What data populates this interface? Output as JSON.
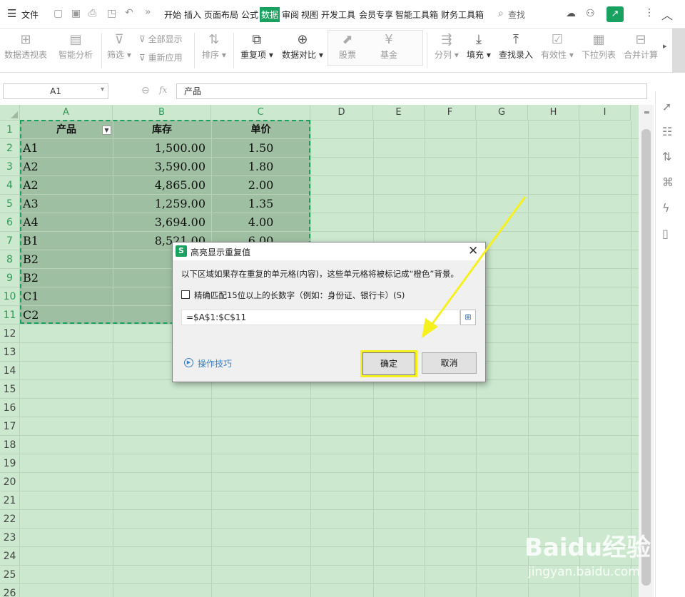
{
  "menubar": {
    "file": "文件",
    "tabs": [
      "开始",
      "插入",
      "页面布局",
      "公式",
      "数据",
      "审阅",
      "视图",
      "开发工具",
      "会员专享",
      "智能工具箱",
      "财务工具箱"
    ],
    "active_tab": "数据",
    "search": "查找"
  },
  "ribbon": {
    "pivot": "数据透视表",
    "smart": "智能分析",
    "filter": "筛选",
    "show_all": "全部显示",
    "reapply": "重新应用",
    "sort": "排序",
    "duplicates": "重复项",
    "compare": "数据对比",
    "stock": "股票",
    "fund": "基金",
    "split": "分列",
    "fill": "填充",
    "lookup": "查找录入",
    "validity": "有效性",
    "dropdown": "下拉列表",
    "consolidate": "合并计算"
  },
  "formula_bar": {
    "name_box": "A1",
    "fx": "fx",
    "content": "产品"
  },
  "columns": [
    "A",
    "B",
    "C",
    "D",
    "E",
    "F",
    "G",
    "H",
    "I"
  ],
  "rows": [
    "1",
    "2",
    "3",
    "4",
    "5",
    "6",
    "7",
    "8",
    "9",
    "10",
    "11",
    "12",
    "13",
    "14",
    "15",
    "16",
    "17",
    "18",
    "19",
    "20",
    "21",
    "22",
    "23",
    "24",
    "25",
    "26"
  ],
  "table": {
    "headers": [
      "产品",
      "库存",
      "单价"
    ],
    "rows": [
      [
        "A1",
        "1,500.00",
        "1.50"
      ],
      [
        "A2",
        "3,590.00",
        "1.80"
      ],
      [
        "A2",
        "4,865.00",
        "2.00"
      ],
      [
        "A3",
        "1,259.00",
        "1.35"
      ],
      [
        "A4",
        "3,694.00",
        "4.00"
      ],
      [
        "B1",
        "8,521.00",
        "6.00"
      ],
      [
        "B2",
        "6,9",
        ""
      ],
      [
        "B2",
        "4,5",
        ""
      ],
      [
        "C1",
        "3,4",
        ""
      ],
      [
        "C2",
        "7,1",
        ""
      ]
    ]
  },
  "dialog": {
    "title": "高亮显示重复值",
    "description": "以下区域如果存在重复的单元格(内容)，这些单元格将被标记成“橙色”背景。",
    "checkbox_label": "精确匹配15位以上的长数字（例如：身份证、银行卡）(S)",
    "range": "=$A$1:$C$11",
    "tips": "操作技巧",
    "ok": "确定",
    "cancel": "取消"
  },
  "watermark": {
    "brand": "Baidu经验",
    "url": "jingyan.baidu.com"
  },
  "colors": {
    "accent": "#19a15f",
    "grid_bg": "#cce8cf",
    "selection": "#9fbfa2",
    "highlight": "#f7f020"
  }
}
